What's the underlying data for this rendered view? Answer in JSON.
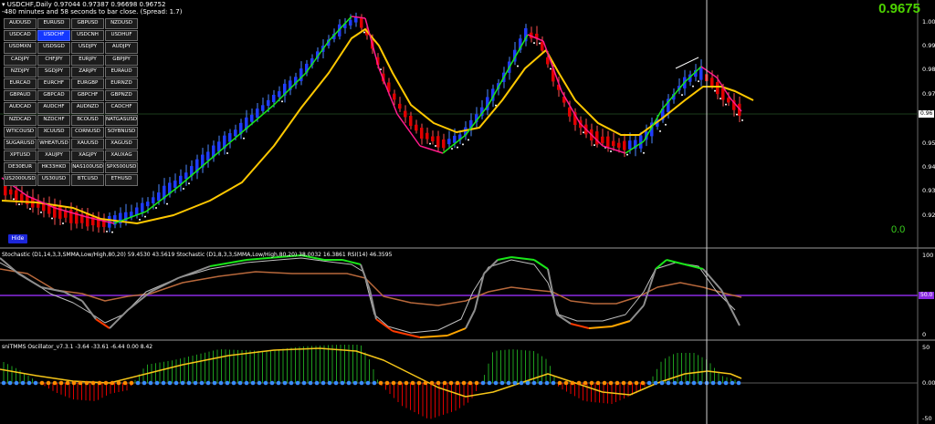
{
  "header": {
    "line1": "▾ USDCHF,Daily  0.97044 0.97387 0.96698 0.96752",
    "line2": "-480 minutes and 58 seconds to bar close. (Spread: 1.7)"
  },
  "big_price": "0.9675",
  "zero_value": "0.0",
  "hide_label": "Hide",
  "active_symbol": "USDCHF",
  "symbols": [
    "AUDUSD",
    "EURUSD",
    "GBPUSD",
    "NZDUSD",
    "USDCAD",
    "USDCHF",
    "USDCNH",
    "USDHUF",
    "USDMXN",
    "USDSGD",
    "USDJPY",
    "AUDJPY",
    "CADJPY",
    "CHFJPY",
    "EURJPY",
    "GBPJPY",
    "NZDJPY",
    "SGDJPY",
    "ZARJPY",
    "EURAUD",
    "EURCAD",
    "EURCHF",
    "EURGBP",
    "EURNZD",
    "GBPAUD",
    "GBPCAD",
    "GBPCHF",
    "GBPNZD",
    "AUDCAD",
    "AUDCHF",
    "AUDNZD",
    "CADCHF",
    "NZDCAD",
    "NZDCHF",
    "BCOUSD",
    "NATGASUSD",
    "WTICOUSD",
    "XCUUSD",
    "CORNUSD",
    "SOYBNUSD",
    "SUGARUSD",
    "WHEATUSD",
    "XAUUSD",
    "XAGUSD",
    "XPTUSD",
    "XAUJPY",
    "XAGJPY",
    "XAUXAG",
    "DE30EUR",
    "HK33HKD",
    "NAS100USD",
    "SPX500USD",
    "US2000USD",
    "US30USD",
    "BTCUSD",
    "ETHUSD"
  ],
  "price_axis": {
    "ticks": [
      "1.00",
      "0.99",
      "0.98",
      "0.97",
      "0.96",
      "0.95",
      "0.94",
      "0.93",
      "0.92"
    ],
    "current_price_tag": "0.96"
  },
  "stochastic_panel": {
    "label": "Stochastic (D1,14,3,3,SMMA,Low/High,80,20) 59.4530 43.5619  Stochastic (D1,8,3,3,SMMA,Low/High,80,20) 38.0032 16.3861  RSI(14) 46.3595",
    "ticks": [
      "100",
      "0"
    ],
    "level_tag": "50.0"
  },
  "oscillator_panel": {
    "label": "sniTMMS Oscillator_v7.3.1 -3.64 -33.61 -6.44 0.00 8.42",
    "ticks": [
      "50",
      "0.00",
      "-50"
    ]
  },
  "colors": {
    "background": "#000000",
    "big_price": "#4dd200",
    "bull_candle": "#1f3cff",
    "bear_candle": "#e00000",
    "ma_fast_green": "#19e619",
    "ma_fast_magenta": "#ff1a8c",
    "ma_slow": "#ffc800",
    "level_line": "#8a2be2",
    "rsi": "#b8683b",
    "hist_positive": "#1e9e1e",
    "hist_negative": "#e00000",
    "zero_dots_up": "#3a8cff",
    "zero_dots_down": "#ff8c00"
  }
}
